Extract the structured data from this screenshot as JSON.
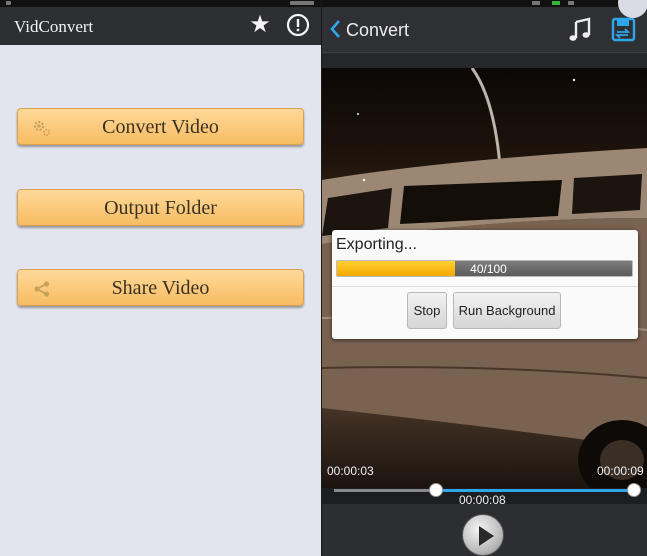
{
  "left": {
    "app_title": "VidConvert",
    "icons": {
      "favorite": "star-icon",
      "info": "info-icon"
    },
    "menu": [
      {
        "label": "Convert Video",
        "icon": "gear-icon"
      },
      {
        "label": "Output Folder",
        "icon": ""
      },
      {
        "label": "Share Video",
        "icon": "share-icon"
      }
    ],
    "colors": {
      "appbar": "#2d2f33",
      "background": "#e3e5ee",
      "button": "#f7bc62"
    }
  },
  "right": {
    "header": {
      "title": "Convert",
      "icons": [
        "back-chevron-icon",
        "music-note-icon",
        "save-icon"
      ]
    },
    "dialog": {
      "title": "Exporting...",
      "progress_text": "40/100",
      "progress_fraction": 0.4,
      "buttons": {
        "stop": "Stop",
        "run_background": "Run Background"
      }
    },
    "times": {
      "start": "00:00:03",
      "end": "00:00:09",
      "current": "00:00:08"
    },
    "trim": {
      "start_fraction": 0.34,
      "end_fraction": 1.0
    },
    "colors": {
      "accent": "#2ea6ea",
      "progress": "#f4a800",
      "header": "#2f3034"
    }
  }
}
